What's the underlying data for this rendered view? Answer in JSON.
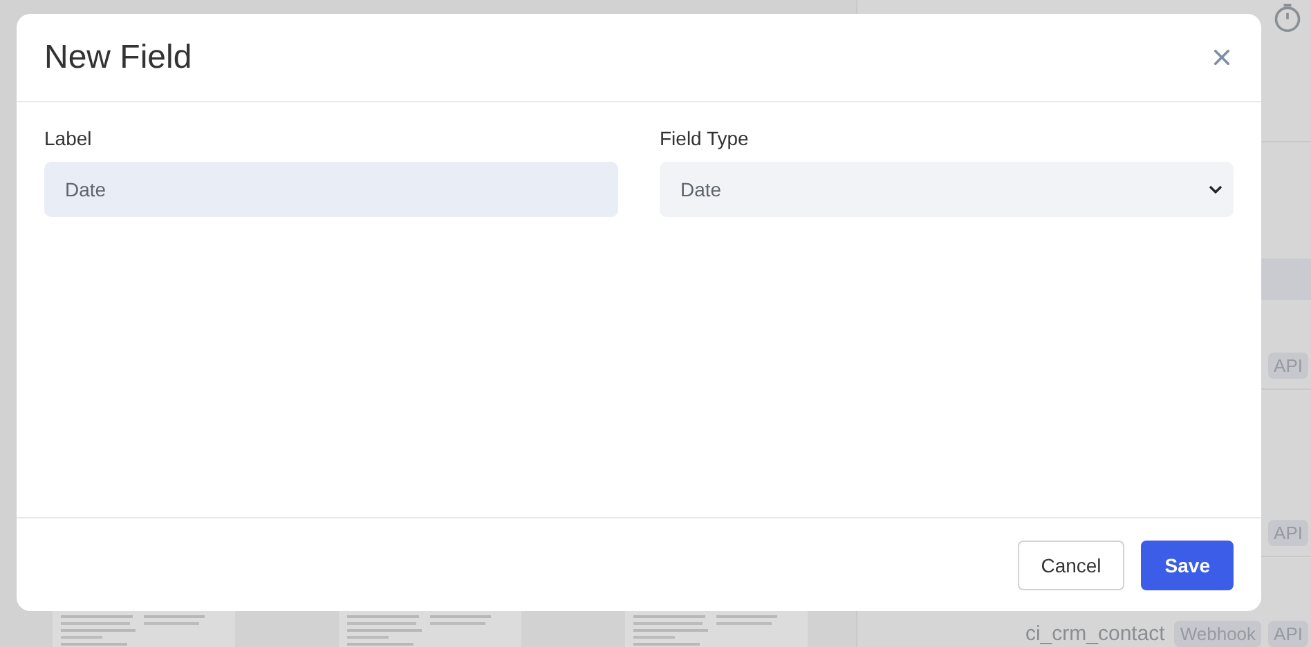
{
  "background": {
    "rows": [
      {
        "tags": [
          "API"
        ]
      },
      {
        "tags": [
          "API"
        ]
      },
      {
        "name": "ci_crm_contact",
        "tags": [
          "Webhook",
          "API"
        ]
      }
    ]
  },
  "modal": {
    "title": "New Field",
    "fields": [
      {
        "label": "Label",
        "kind": "input",
        "value": "Date"
      },
      {
        "label": "Field Type",
        "kind": "select",
        "value": "Date"
      }
    ],
    "buttons": [
      {
        "label": "Cancel",
        "kind": "secondary"
      },
      {
        "label": "Save",
        "kind": "primary"
      }
    ]
  }
}
